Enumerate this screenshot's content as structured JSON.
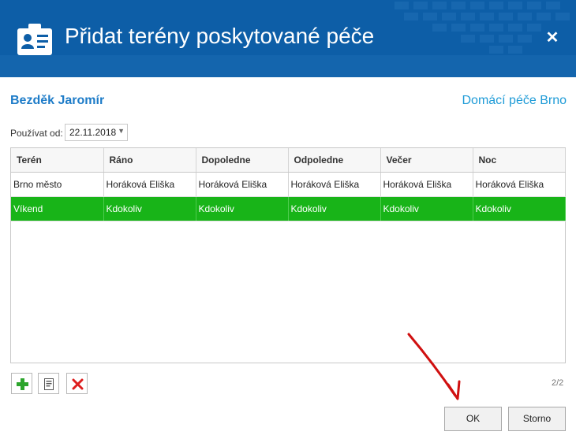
{
  "header": {
    "title": "Přidat terény poskytované péče",
    "icon": "id-card-icon",
    "close": "✕"
  },
  "client": {
    "name": "Bezděk Jaromír",
    "organization": "Domácí péče Brno"
  },
  "date_filter": {
    "label": "Používat od:",
    "value": "22.11.2018"
  },
  "grid": {
    "columns": [
      "Terén",
      "Ráno",
      "Dopoledne",
      "Odpoledne",
      "Večer",
      "Noc"
    ],
    "rows": [
      [
        "Brno město",
        "Horáková Eliška",
        "Horáková Eliška",
        "Horáková Eliška",
        "Horáková Eliška",
        "Horáková Eliška"
      ],
      [
        "Víkend",
        "Kdokoliv",
        "Kdokoliv",
        "Kdokoliv",
        "Kdokoliv",
        "Kdokoliv"
      ]
    ],
    "selected_row": 1
  },
  "toolbar": {
    "add_icon": "plus-icon",
    "edit_icon": "document-icon",
    "delete_icon": "x-icon"
  },
  "pager": {
    "text": "2/2"
  },
  "buttons": {
    "ok": "OK",
    "cancel": "Storno"
  },
  "colors": {
    "header_bg": "#0d5ea7",
    "selected_row": "#18b418",
    "client_name": "#1e7cc8",
    "annotation_arrow": "#d01010"
  }
}
